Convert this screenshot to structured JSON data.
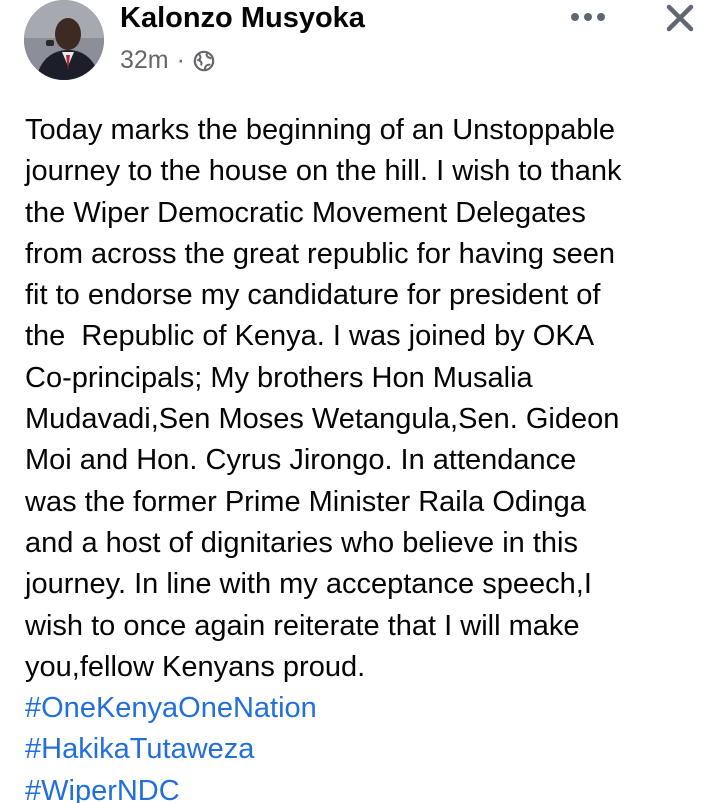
{
  "post": {
    "author": "Kalonzo Musyoka",
    "time": "32m",
    "separator": "·",
    "audience_icon": "globe-icon",
    "body_lines": [
      "Today marks the beginning of an Unstoppable",
      "journey to the house on the hill. I wish to thank",
      "the Wiper Democratic Movement Delegates",
      "from across the great republic for having seen",
      "fit to endorse my candidature for president of",
      "the  Republic of Kenya. I was joined by OKA",
      "Co-principals; My brothers Hon Musalia",
      "Mudavadi,Sen Moses Wetangula,Sen. Gideon",
      "Moi and Hon. Cyrus Jirongo. In attendance",
      "was the former Prime Minister Raila Odinga",
      "and a host of dignitaries who believe in this",
      "journey. In line with my acceptance speech,I",
      "wish to once again reiterate that I will make",
      "you,fellow Kenyans proud."
    ],
    "hashtags": [
      "#OneKenyaOneNation",
      "#HakikaTutaweza",
      "#WiperNDC"
    ]
  },
  "header_actions": {
    "more_icon": "more-horizontal-icon",
    "close_icon": "close-icon"
  },
  "colors": {
    "text": "#050505",
    "secondary": "#65676b",
    "link": "#216fdb",
    "icon": "#606770"
  }
}
